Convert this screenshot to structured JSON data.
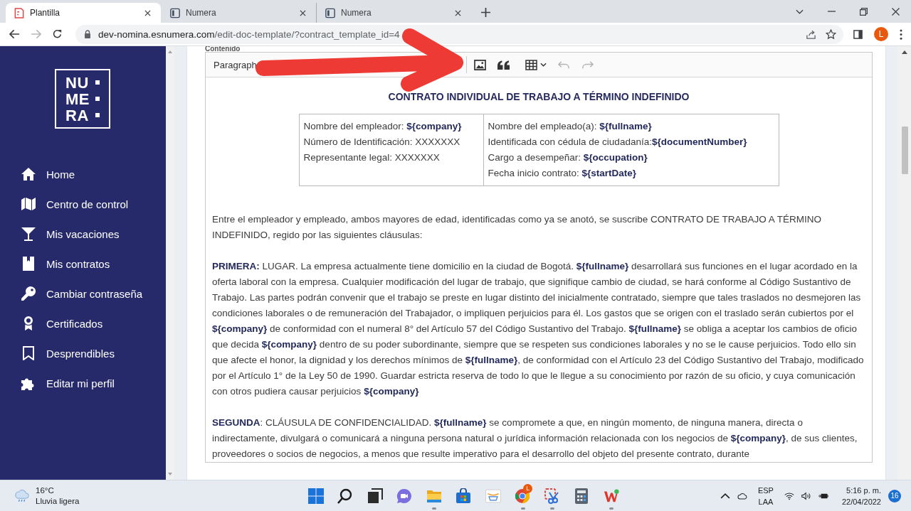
{
  "browser": {
    "tabs": [
      {
        "title": "Plantilla",
        "selected": true
      },
      {
        "title": "Numera",
        "selected": false
      },
      {
        "title": "Numera",
        "selected": false
      }
    ],
    "url": {
      "host": "dev-nomina.esnumera.com",
      "path": "/edit-doc-template/?contract_template_id=4"
    },
    "profile_initial": "L"
  },
  "sidebar": {
    "logo": [
      "NU",
      "ME",
      "RA"
    ],
    "items": [
      {
        "label": "Home"
      },
      {
        "label": "Centro de control"
      },
      {
        "label": "Mis vacaciones"
      },
      {
        "label": "Mis contratos"
      },
      {
        "label": "Cambiar contraseña"
      },
      {
        "label": "Certificados"
      },
      {
        "label": "Desprendibles"
      },
      {
        "label": "Editar mi perfil"
      }
    ]
  },
  "editor": {
    "label": "Contenido",
    "toolbar": {
      "block_format": "Paragraph",
      "undo_disabled": true,
      "redo_disabled": true
    },
    "heading": "CONTRATO INDIVIDUAL DE TRABAJO A TÉRMINO INDEFINIDO",
    "table": {
      "columns": [
        [
          "Nombre del empleador: **${company}**",
          "Número de Identificación: XXXXXXX",
          "Representante legal: XXXXXXX"
        ],
        [
          "Nombre del empleado(a): **${fullname}**",
          "Identificada con cédula de ciudadanía:**${documentNumber}**",
          "Cargo a desempeñar: **${occupation}**",
          "Fecha inicio contrato: **${startDate}**"
        ]
      ]
    },
    "paragraphs": [
      "Entre el empleador y empleado, ambos mayores de edad, identificadas como ya se anotó, se suscribe CONTRATO DE TRABAJO A TÉRMINO INDEFINIDO, regido por las siguientes cláusulas:",
      "**PRIMERA:** LUGAR. La empresa actualmente tiene domicilio en la ciudad de Bogotá. **${fullname}** desarrollará sus funciones en el lugar acordado en la oferta laboral con la empresa. Cualquier modificación del lugar de trabajo, que signifique cambio de ciudad, se hará conforme al Código Sustantivo de Trabajo. Las partes podrán convenir que el trabajo se preste en lugar distinto del inicialmente contratado, siempre que tales traslados no desmejoren las condiciones laborales o de remuneración del Trabajador, o impliquen perjuicios para él.  Los gastos que se origen con el traslado serán cubiertos por el **${company}** de conformidad con el numeral 8° del Artículo 57 del Código Sustantivo del Trabajo.  **${fullname}** se obliga a aceptar los cambios de oficio que decida **${company}** dentro de su poder subordinante, siempre que se respeten sus condiciones laborales y no se le cause perjuicios. Todo ello sin que afecte el honor, la dignidad y los derechos mínimos de **${fullname}**, de conformidad con el Artículo 23 del Código Sustantivo del Trabajo, modificado por el Artículo 1° de la Ley 50 de 1990. Guardar estricta reserva de todo lo que le llegue a su conocimiento por razón de su oficio, y cuya comunicación con otros pudiera causar perjuicios **${company}**",
      "**SEGUNDA**: CLÁUSULA DE CONFIDENCIALIDAD. **${fullname}** se compromete a que, en ningún momento, de ninguna manera, directa o indirectamente, divulgará o comunicará a ninguna persona natural o jurídica información relacionada con los negocios de **${company}**, de sus clientes, proveedores o socios de negocios, a menos que resulte imperativo para el desarrollo del objeto del presente contrato, durante"
    ]
  },
  "taskbar": {
    "weather": {
      "temperature": "16°C",
      "condition": "Lluvia ligera"
    },
    "apps": [
      {
        "running": false
      },
      {
        "running": false
      },
      {
        "running": false
      },
      {
        "running": false
      },
      {
        "running": true
      },
      {
        "running": false
      },
      {
        "running": false
      },
      {
        "running": true,
        "badge": "L"
      },
      {
        "running": true
      },
      {
        "running": false
      },
      {
        "running": true
      }
    ],
    "language": [
      "ESP",
      "LAA"
    ],
    "time": "5:16 p. m.",
    "date": "22/04/2022",
    "notifications": "16"
  }
}
